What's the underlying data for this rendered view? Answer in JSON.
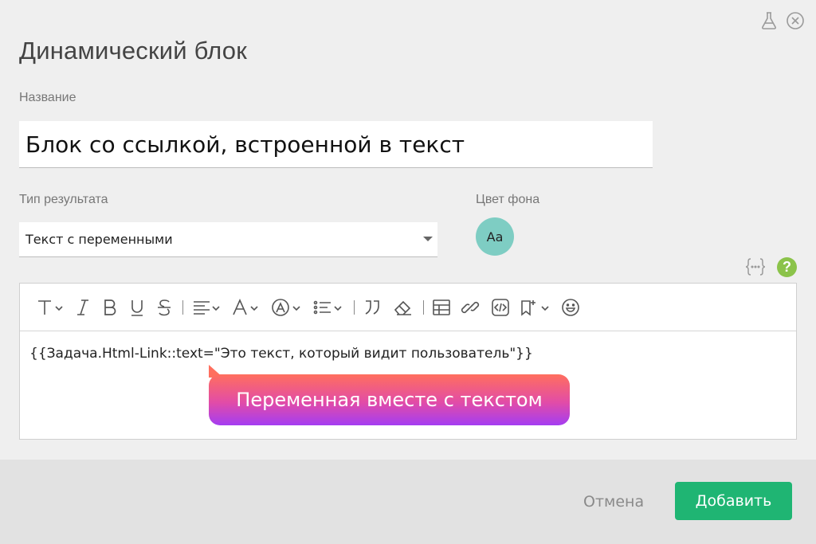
{
  "dialog": {
    "title": "Динамический блок",
    "top_icons": [
      "flask-icon",
      "close-icon"
    ]
  },
  "name_field": {
    "label": "Название",
    "value": "Блок со ссылкой, встроенной в текст"
  },
  "result_type": {
    "label": "Тип результата",
    "selected": "Текст с переменными"
  },
  "bg_color": {
    "label": "Цвет фона",
    "swatch_text": "Aa",
    "swatch_color": "#7ecdc3"
  },
  "editor": {
    "toolbar": [
      "text-style-icon",
      "italic-icon",
      "bold-icon",
      "underline-icon",
      "strikethrough-icon",
      "align-icon",
      "font-color-icon",
      "highlight-icon",
      "list-icon",
      "quote-icon",
      "eraser-icon",
      "table-icon",
      "link-icon",
      "code-icon",
      "bookmark-add-icon",
      "emoji-icon"
    ],
    "content": "{{Задача.Html-Link::text=\"Это текст, который видит пользователь\"}}"
  },
  "callout": {
    "text": "Переменная вместе с текстом"
  },
  "footer": {
    "cancel_label": "Отмена",
    "add_label": "Добавить"
  },
  "colors": {
    "accent": "#1fb573",
    "help": "#8bc34a"
  }
}
